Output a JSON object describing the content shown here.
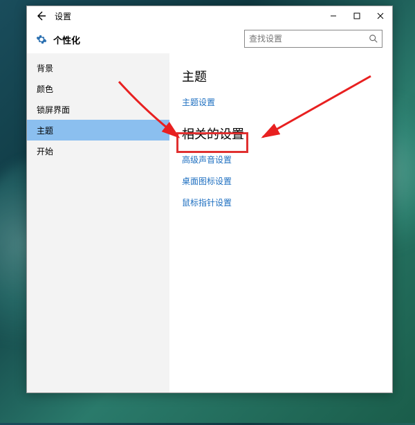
{
  "window": {
    "app_name": "设置"
  },
  "header": {
    "heading": "个性化"
  },
  "search": {
    "placeholder": "查找设置"
  },
  "sidebar": {
    "items": [
      {
        "label": "背景"
      },
      {
        "label": "颜色"
      },
      {
        "label": "锁屏界面"
      },
      {
        "label": "主题"
      },
      {
        "label": "开始"
      }
    ],
    "active_index": 3
  },
  "content": {
    "section1_title": "主题",
    "link_theme_settings": "主题设置",
    "section2_title": "相关的设置",
    "link_sound": "高级声音设置",
    "link_desktop_icons": "桌面图标设置",
    "link_mouse_pointer": "鼠标指针设置"
  }
}
